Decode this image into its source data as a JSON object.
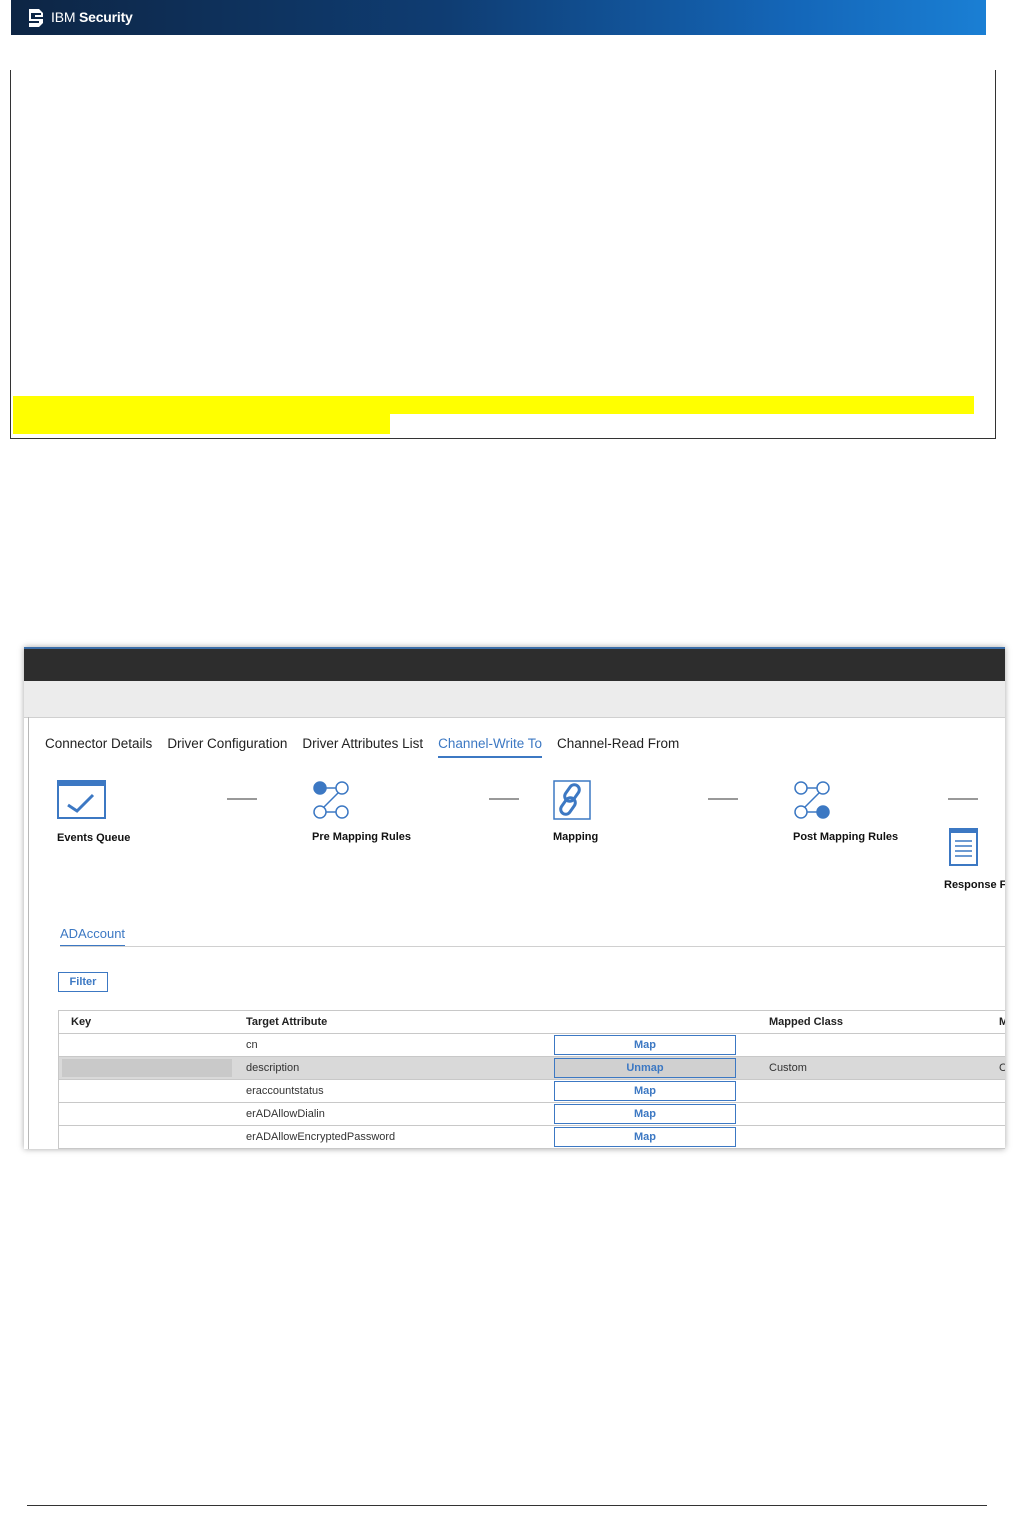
{
  "banner": {
    "brand_prefix": "IBM",
    "brand_suffix": "Security"
  },
  "tabs": [
    {
      "label": "Connector Details",
      "active": false
    },
    {
      "label": "Driver Configuration",
      "active": false
    },
    {
      "label": "Driver Attributes List",
      "active": false
    },
    {
      "label": "Channel-Write To",
      "active": true
    },
    {
      "label": "Channel-Read From",
      "active": false
    }
  ],
  "steps": {
    "events_queue": "Events Queue",
    "pre_mapping": "Pre Mapping Rules",
    "mapping": "Mapping",
    "post_mapping": "Post Mapping Rules",
    "response": "Response F"
  },
  "subtab": "ADAccount",
  "filter_label": "Filter",
  "table": {
    "headers": {
      "key": "Key",
      "target": "Target Attribute",
      "mapped_class": "Mapped Class",
      "extra": "M"
    },
    "rows": [
      {
        "key": "",
        "target": "cn",
        "action": "Map",
        "mapped_class": "",
        "extra": ""
      },
      {
        "key": "",
        "target": "description",
        "action": "Unmap",
        "mapped_class": "Custom",
        "extra": "C"
      },
      {
        "key": "",
        "target": "eraccountstatus",
        "action": "Map",
        "mapped_class": "",
        "extra": ""
      },
      {
        "key": "",
        "target": "erADAllowDialin",
        "action": "Map",
        "mapped_class": "",
        "extra": ""
      },
      {
        "key": "",
        "target": "erADAllowEncryptedPassword",
        "action": "Map",
        "mapped_class": "",
        "extra": ""
      }
    ]
  },
  "colors": {
    "accent": "#3c78c3",
    "highlight": "#ffff00",
    "dark_bar": "#2d2d2d"
  }
}
